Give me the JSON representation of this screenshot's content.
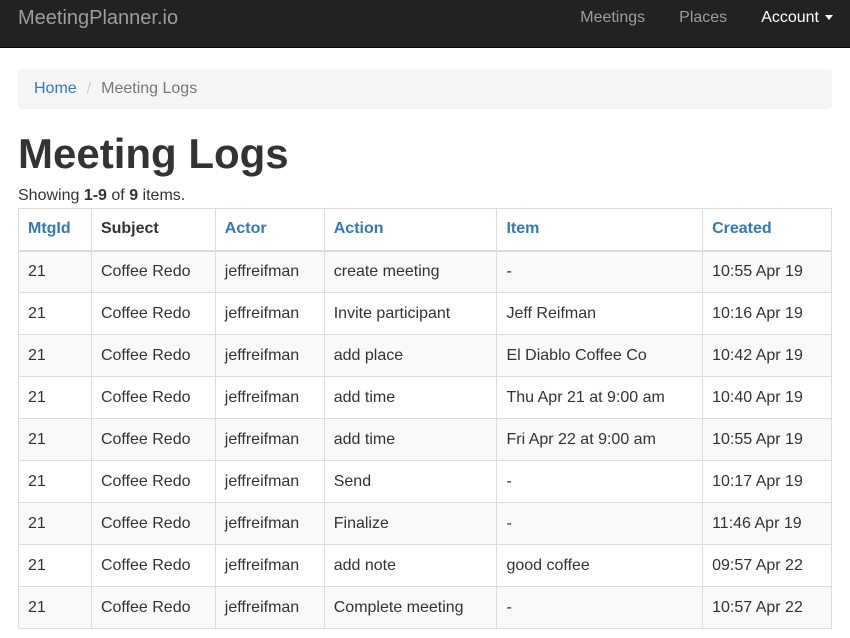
{
  "navbar": {
    "brand": "MeetingPlanner.io",
    "items": [
      {
        "label": "Meetings"
      },
      {
        "label": "Places"
      },
      {
        "label": "Account"
      }
    ]
  },
  "breadcrumb": {
    "home": "Home",
    "separator": "/",
    "current": "Meeting Logs"
  },
  "page": {
    "title": "Meeting Logs",
    "summary": {
      "prefix": "Showing ",
      "range": "1-9",
      "middle": " of ",
      "total": "9",
      "suffix": " items."
    }
  },
  "table": {
    "headers": [
      {
        "label": "MtgId",
        "sortable": true
      },
      {
        "label": "Subject",
        "sortable": false
      },
      {
        "label": "Actor",
        "sortable": true
      },
      {
        "label": "Action",
        "sortable": true
      },
      {
        "label": "Item",
        "sortable": true
      },
      {
        "label": "Created",
        "sortable": true
      }
    ],
    "rows": [
      [
        "21",
        "Coffee Redo",
        "jeffreifman",
        "create meeting",
        "-",
        "10:55 Apr 19"
      ],
      [
        "21",
        "Coffee Redo",
        "jeffreifman",
        "Invite participant",
        "Jeff Reifman",
        "10:16 Apr 19"
      ],
      [
        "21",
        "Coffee Redo",
        "jeffreifman",
        "add place",
        "El Diablo Coffee Co",
        "10:42 Apr 19"
      ],
      [
        "21",
        "Coffee Redo",
        "jeffreifman",
        "add time",
        "Thu Apr 21 at 9:00 am",
        "10:40 Apr 19"
      ],
      [
        "21",
        "Coffee Redo",
        "jeffreifman",
        "add time",
        "Fri Apr 22 at 9:00 am",
        "10:55 Apr 19"
      ],
      [
        "21",
        "Coffee Redo",
        "jeffreifman",
        "Send",
        "-",
        "10:17 Apr 19"
      ],
      [
        "21",
        "Coffee Redo",
        "jeffreifman",
        "Finalize",
        "-",
        "11:46 Apr 19"
      ],
      [
        "21",
        "Coffee Redo",
        "jeffreifman",
        "add note",
        "good coffee",
        "09:57 Apr 22"
      ],
      [
        "21",
        "Coffee Redo",
        "jeffreifman",
        "Complete meeting",
        "-",
        "10:57 Apr 22"
      ]
    ]
  },
  "colors": {
    "navbar_bg": "#222222",
    "link": "#337ab7",
    "text": "#333333",
    "muted": "#777777"
  }
}
